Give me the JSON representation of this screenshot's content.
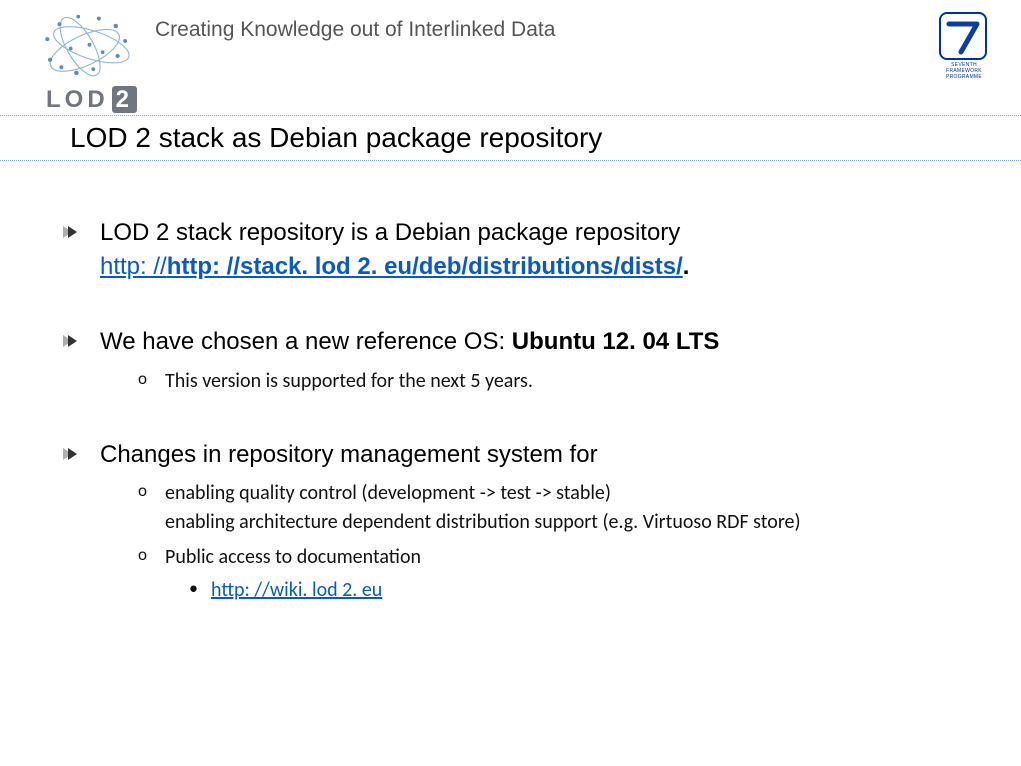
{
  "header": {
    "tagline": "Creating Knowledge out of Interlinked Data",
    "logo_text_a": "LOD",
    "logo_text_b": "2",
    "fp7_label": "SEVENTH FRAMEWORK PROGRAMME"
  },
  "title": "LOD 2 stack as Debian package repository",
  "bullets": {
    "b1_intro": "LOD 2 stack repository is a Debian package repository ",
    "b1_link_prefix": "http: //",
    "b1_link_rest": "http: //stack. lod 2. eu/deb/distributions/dists/",
    "b1_period": ".",
    "b2_intro": "We have chosen a new reference OS: ",
    "b2_bold": "Ubuntu 12. 04 LTS",
    "b2_sub1": "This version is supported for the next 5 years.",
    "b3_intro": "Changes in repository management system for",
    "b3_sub1_line1": "enabling quality control (development -> test -> stable)",
    "b3_sub1_line2": "enabling architecture dependent distribution support (e.g. Virtuoso RDF store)",
    "b3_sub2": "Public access to documentation",
    "b3_sub2_link": "http: //wiki. lod 2. eu"
  }
}
